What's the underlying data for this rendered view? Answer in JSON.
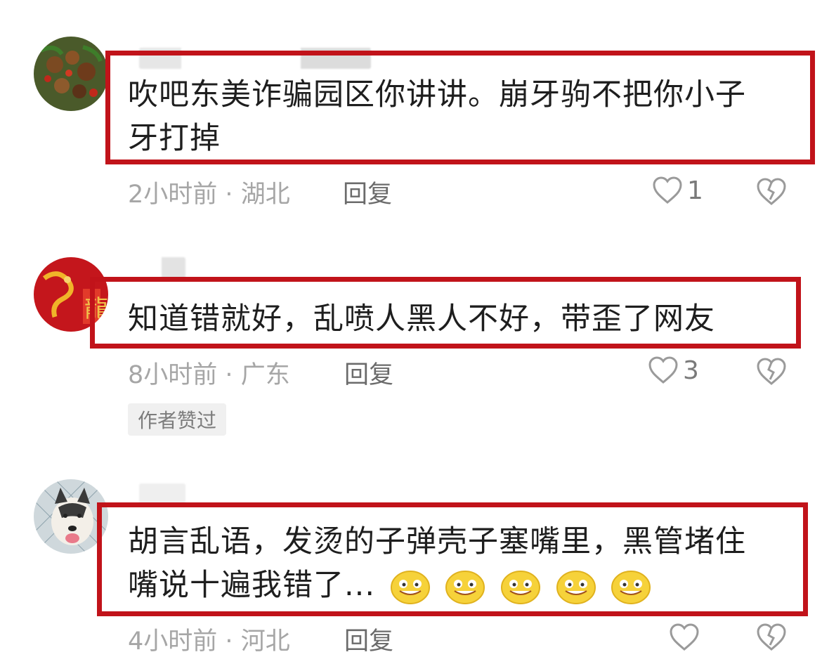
{
  "comments": [
    {
      "text_line1": "吹吧东美诈骗园区你讲讲。崩牙驹不把你小子",
      "text_line2": "牙打掉",
      "time": "2小时前",
      "location": "湖北",
      "reply": "回复",
      "likes": "1"
    },
    {
      "text_line1": "知道错就好，乱喷人黑人不好，带歪了网友",
      "time": "8小时前",
      "location": "广东",
      "reply": "回复",
      "likes": "3",
      "badge": "作者赞过"
    },
    {
      "text_line1": "胡言乱语，发烫的子弹壳子塞嘴里，黑管堵住",
      "text_line2": "嘴说十遍我错了...",
      "time": "4小时前",
      "location": "河北",
      "reply": "回复",
      "likes": ""
    }
  ],
  "separator": "·",
  "colors": {
    "highlight_box": "#c1131a",
    "meta_text": "#a6a6a6"
  }
}
